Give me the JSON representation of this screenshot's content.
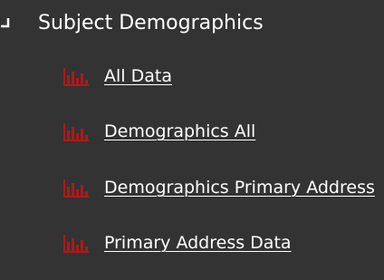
{
  "tree": {
    "folder": {
      "label": "Subject Demographics",
      "expanded": true,
      "icon": "tree-collapse-icon"
    },
    "items": [
      {
        "label": "All Data",
        "icon": "report-bar-chart-icon"
      },
      {
        "label": "Demographics All",
        "icon": "report-bar-chart-icon"
      },
      {
        "label": "Demographics Primary Address",
        "icon": "report-bar-chart-icon"
      },
      {
        "label": "Primary Address Data",
        "icon": "report-bar-chart-icon"
      }
    ]
  },
  "colors": {
    "background": "#333333",
    "text": "#ffffff",
    "icon_accent": "#b01818"
  }
}
